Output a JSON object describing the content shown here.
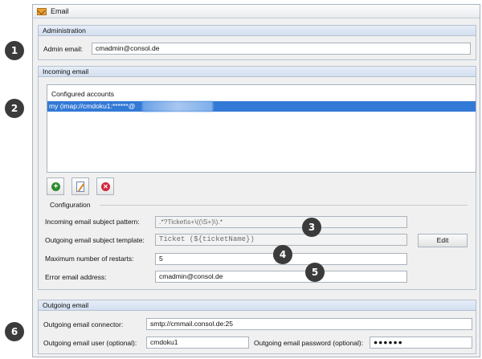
{
  "window": {
    "title": "Email"
  },
  "administration": {
    "header": "Administration",
    "admin_email_label": "Admin email:",
    "admin_email_value": "cmadmin@consol.de"
  },
  "incoming": {
    "header": "Incoming email",
    "accounts_header": "Configured accounts",
    "selected_account": "my (imap://cmdoku1:******@"
  },
  "configuration": {
    "title": "Configuration",
    "subject_pattern_label": "Incoming email subject pattern:",
    "subject_pattern_value": ".*?Ticket\\s+\\((\\S+)\\).*",
    "subject_template_label": "Outgoing email subject template:",
    "subject_template_value": "Ticket (${ticketName})",
    "edit_button": "Edit",
    "max_restarts_label": "Maximum number of restarts:",
    "max_restarts_value": "5",
    "error_email_label": "Error email address:",
    "error_email_value": "cmadmin@consol.de"
  },
  "outgoing": {
    "header": "Outgoing email",
    "connector_label": "Outgoing email connector:",
    "connector_value": "smtp://cmmail.consol.de:25",
    "user_label": "Outgoing email user (optional):",
    "user_value": "cmdoku1",
    "password_label": "Outgoing email password (optional):",
    "password_value": "●●●●●●"
  },
  "badges": [
    "1",
    "2",
    "3",
    "4",
    "5",
    "6"
  ]
}
